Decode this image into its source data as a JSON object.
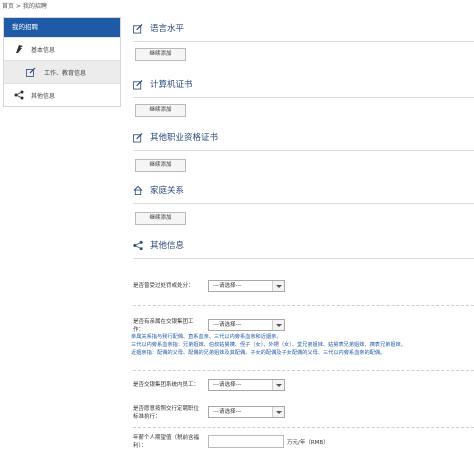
{
  "breadcrumb": "首页 > 我的招聘",
  "sidebar": {
    "header": "我的招聘",
    "items": [
      {
        "label": "基本信息",
        "icon": "quill-icon"
      },
      {
        "label": "工作、教育信息",
        "icon": "edit-icon"
      },
      {
        "label": "其他信息",
        "icon": "share-icon"
      }
    ]
  },
  "sections": [
    {
      "title": "语言水平",
      "icon": "edit-icon",
      "button": "继续添加"
    },
    {
      "title": "计算机证书",
      "icon": "edit-icon",
      "button": "继续添加"
    },
    {
      "title": "其他职业资格证书",
      "icon": "edit-icon",
      "button": "继续添加"
    },
    {
      "title": "家庭关系",
      "icon": "home-icon",
      "button": "继续添加"
    },
    {
      "title": "其他信息",
      "icon": "share-icon"
    }
  ],
  "questions": {
    "q1": {
      "label": "是否曾受过处罚或处分：",
      "value": "---请选择---"
    },
    "q2": {
      "label_1": "是否有亲属在交银集团工",
      "label_2": "作：",
      "value": "---请选择---"
    },
    "note": {
      "line1": "亲属关系指与我行配偶、直系血亲、三代以内旁系血亲和近姻亲。",
      "line2": "三代以内旁系血亲指：兄弟姐妹、伯叔姑舅姨、侄子（女）、外甥（女）、堂兄弟姐妹、姑舅表兄弟姐妹、姨表兄弟姐妹。",
      "line3": "近姻亲指：配偶的父母、配偶的兄弟姐妹及其配偶、子女的配偶及子女配偶的父母、三代以内旁系血亲的配偶。"
    },
    "q3": {
      "label": "是否交银集团系统内员工：",
      "value": "---请选择---"
    },
    "q4": {
      "label_1": "是否愿意按照交行定聘职位",
      "label_2": "标准执行：",
      "value": "---请选择---"
    },
    "q5": {
      "label_1": "年薪个人期望值（税前含福",
      "label_2": "利）：",
      "value": "",
      "unit": "万元/年（RMB）"
    }
  }
}
